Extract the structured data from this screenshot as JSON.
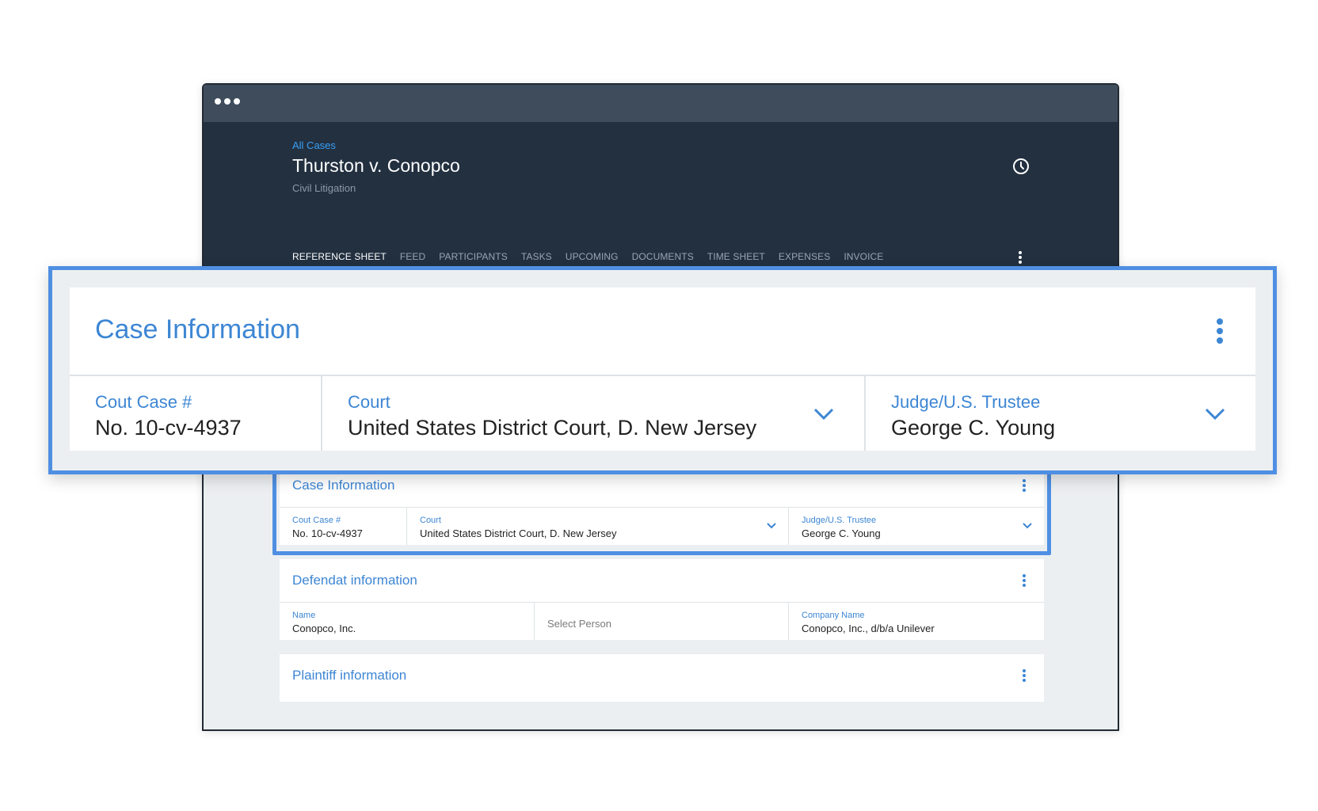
{
  "header": {
    "breadcrumb": "All Cases",
    "title": "Thurston v. Conopco",
    "subtitle": "Civil Litigation",
    "history_icon": "history-clock-icon",
    "more_icon": "more-vertical-icon"
  },
  "tabs": [
    {
      "label": "REFERENCE SHEET",
      "active": true
    },
    {
      "label": "FEED"
    },
    {
      "label": "PARTICIPANTS"
    },
    {
      "label": "TASKS"
    },
    {
      "label": "UPCOMING"
    },
    {
      "label": "DOCUMENTS"
    },
    {
      "label": "TIME SHEET"
    },
    {
      "label": "EXPENSES"
    },
    {
      "label": "INVOICE"
    }
  ],
  "case_info": {
    "title": "Case Information",
    "case_no_label": "Cout Case #",
    "case_no_value": "No. 10-cv-4937",
    "court_label": "Court",
    "court_value": "United States District Court, D. New Jersey",
    "judge_label": "Judge/U.S. Trustee",
    "judge_value": "George C. Young"
  },
  "defendant_info": {
    "title": "Defendat information",
    "name_label": "Name",
    "name_value": "Conopco, Inc.",
    "person_placeholder": "Select Person",
    "company_label": "Company Name",
    "company_value": "Conopco, Inc., d/b/a Unilever"
  },
  "plaintiff_info": {
    "title": "Plaintiff information"
  },
  "colors": {
    "accent": "#3d86d4",
    "highlight": "#4f8fe3",
    "header_bg": "#223040",
    "titlebar_bg": "#3f4c5b"
  }
}
